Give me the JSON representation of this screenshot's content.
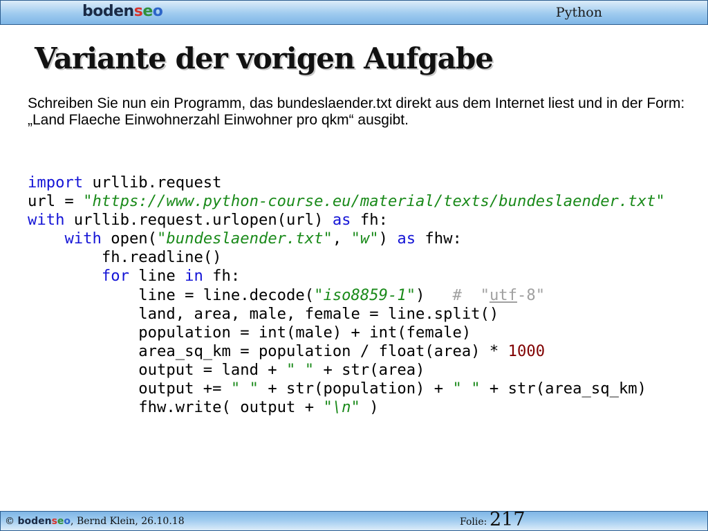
{
  "header": {
    "logo": {
      "part1": "boden",
      "part2": "s",
      "part3": "e",
      "part4": "o"
    },
    "topic": "Python"
  },
  "title": "Variante der vorigen Aufgabe",
  "intro": {
    "line1": "Schreiben Sie nun ein Programm, das bundeslaender.txt direkt aus dem Internet liest und in der Form:",
    "line2": "„Land Flaeche Einwohnerzahl Einwohner pro qkm“ ausgibt."
  },
  "code": {
    "l1": {
      "kw": "import",
      "rest": " urllib.request"
    },
    "l2": {
      "a": "url = ",
      "str": "\"https://www.python-course.eu/material/texts/bundeslaender.txt\""
    },
    "l3": {
      "kw": "with",
      "a": " urllib.request.urlopen(url) ",
      "kw2": "as",
      "b": " fh:"
    },
    "l4": {
      "indent": "    ",
      "kw": "with",
      "a": " open(",
      "s1": "\"bundeslaender.txt\"",
      "b": ", ",
      "s2": "\"w\"",
      "c": ") ",
      "kw2": "as",
      "d": " fhw:"
    },
    "l5": {
      "indent": "        ",
      "a": "fh.readline()"
    },
    "l6": {
      "indent": "        ",
      "kw": "for",
      "a": " line ",
      "kw2": "in",
      "b": " fh:"
    },
    "l7": {
      "indent": "            ",
      "a": "line = line.decode(",
      "s1": "\"iso8859-1\"",
      "b": ")   ",
      "c1": "#  \"",
      "c2": "utf",
      "c3": "-8\""
    },
    "l8": {
      "indent": "            ",
      "a": "land, area, male, female = line.split()"
    },
    "l9": {
      "indent": "            ",
      "a": "population = int(male) + int(female)"
    },
    "l10": {
      "indent": "            ",
      "a": "area_sq_km = population / float(area) * ",
      "num": "1000"
    },
    "l11": {
      "indent": "            ",
      "a": "output = land + ",
      "s1": "\" \"",
      "b": " + str(area)"
    },
    "l12": {
      "indent": "            ",
      "a": "output += ",
      "s1": "\" \"",
      "b": " + str(population) + ",
      "s2": "\" \"",
      "c": " + str(area_sq_km)"
    },
    "l13": {
      "indent": "            ",
      "a": "fhw.write( output + ",
      "s1": "\"\\n\"",
      "b": " )"
    }
  },
  "footer": {
    "copyright_prefix": "© ",
    "logo": {
      "part1": "boden",
      "part2": "s",
      "part3": "e",
      "part4": "o"
    },
    "author": ", Bernd Klein, 26.10.18",
    "folie_label": "Folie:",
    "folie_number": "217"
  },
  "colors": {
    "keyword": "#1515d6",
    "string": "#1a8a1a",
    "number": "#800000",
    "comment": "#a0a0a0",
    "bar_blue": "#9fcbef"
  }
}
